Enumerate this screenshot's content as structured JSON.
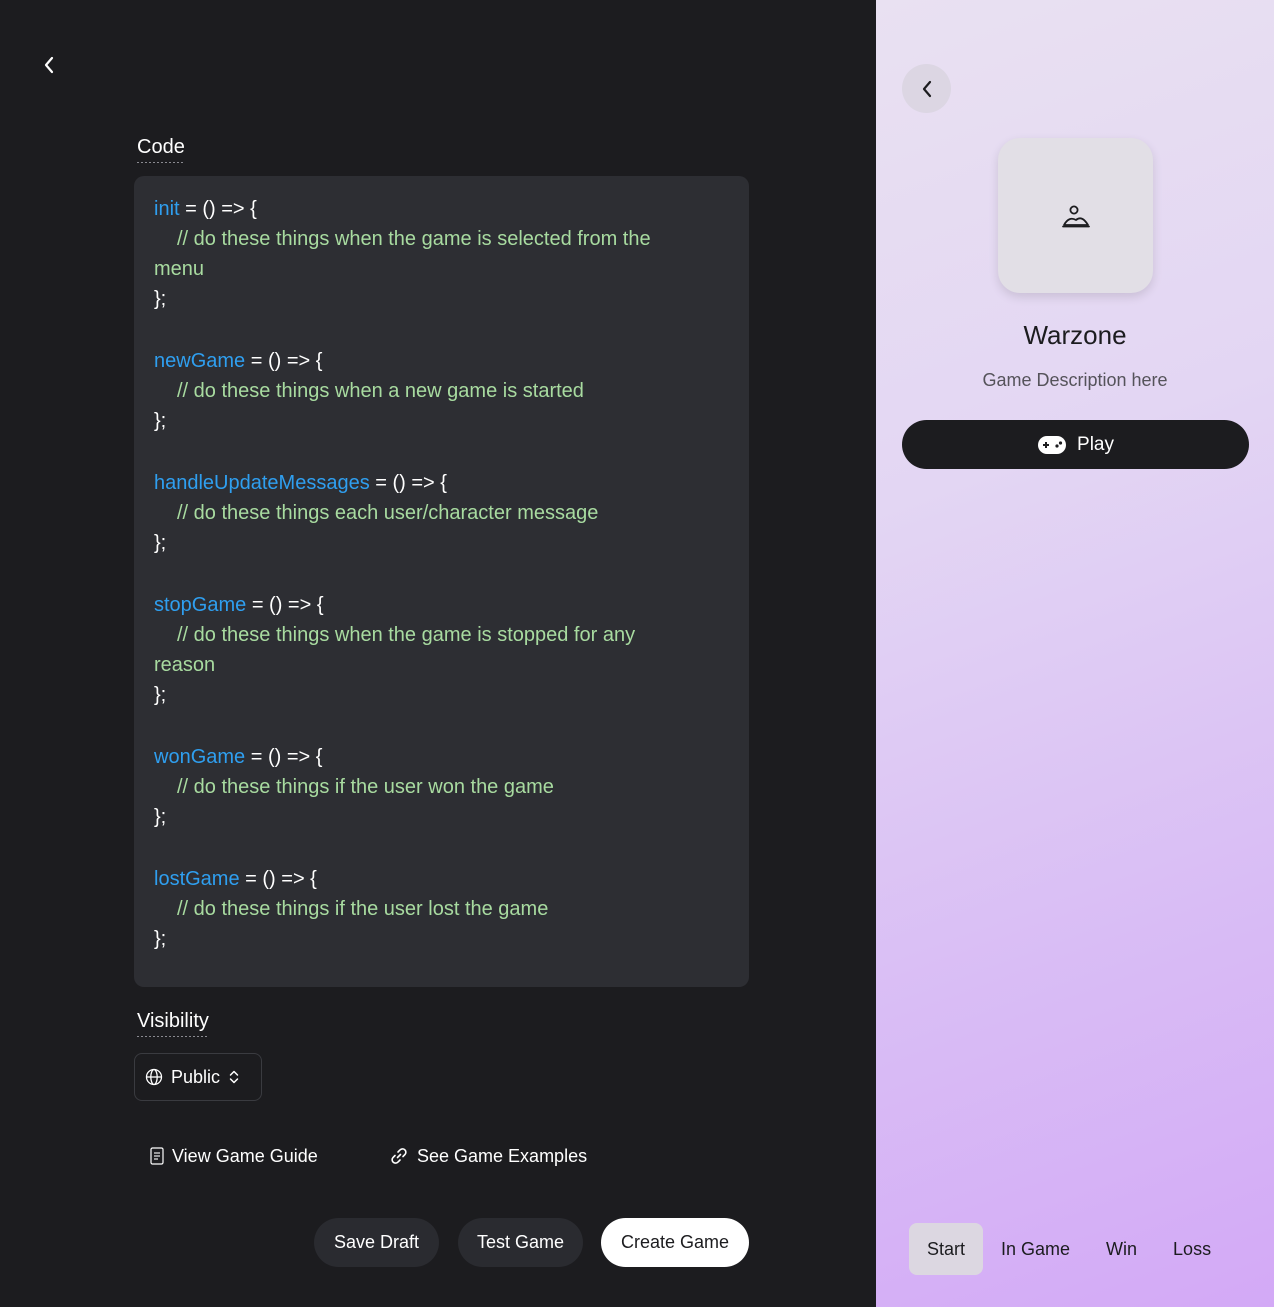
{
  "editor": {
    "code_label": "Code",
    "code_blocks": [
      {
        "fn": "init",
        "sig": " = () => {",
        "comment_lines": [
          "// do these things when the game is selected from the",
          "menu"
        ],
        "close": "};"
      },
      {
        "fn": "newGame",
        "sig": " = () => {",
        "comment_lines": [
          "// do these things when a new game is started"
        ],
        "close": "};"
      },
      {
        "fn": "handleUpdateMessages",
        "sig": " = () => {",
        "comment_lines": [
          "// do these things each user/character message"
        ],
        "close": "};"
      },
      {
        "fn": "stopGame",
        "sig": " = () => {",
        "comment_lines": [
          "// do these things when the game is stopped for any",
          "reason"
        ],
        "close": "};"
      },
      {
        "fn": "wonGame",
        "sig": " = () => {",
        "comment_lines": [
          "// do these things if the user won the game"
        ],
        "close": "};"
      },
      {
        "fn": "lostGame",
        "sig": " = () => {",
        "comment_lines": [
          "// do these things if the user lost the game"
        ],
        "close": "};"
      }
    ],
    "visibility_label": "Visibility",
    "visibility_value": "Public",
    "view_guide_label": "View Game Guide",
    "examples_label": "See Game Examples",
    "save_draft_label": "Save Draft",
    "test_game_label": "Test Game",
    "create_game_label": "Create Game"
  },
  "preview": {
    "title": "Warzone",
    "description": "Game Description here",
    "play_label": "Play",
    "tabs": [
      {
        "label": "Start",
        "active": true
      },
      {
        "label": "In Game",
        "active": false
      },
      {
        "label": "Win",
        "active": false
      },
      {
        "label": "Loss",
        "active": false
      }
    ]
  },
  "colors": {
    "function_name": "#2f9ff0",
    "comment": "#a8dba0",
    "panel_bg": "#1c1c1f",
    "code_bg": "#2d2e33"
  }
}
